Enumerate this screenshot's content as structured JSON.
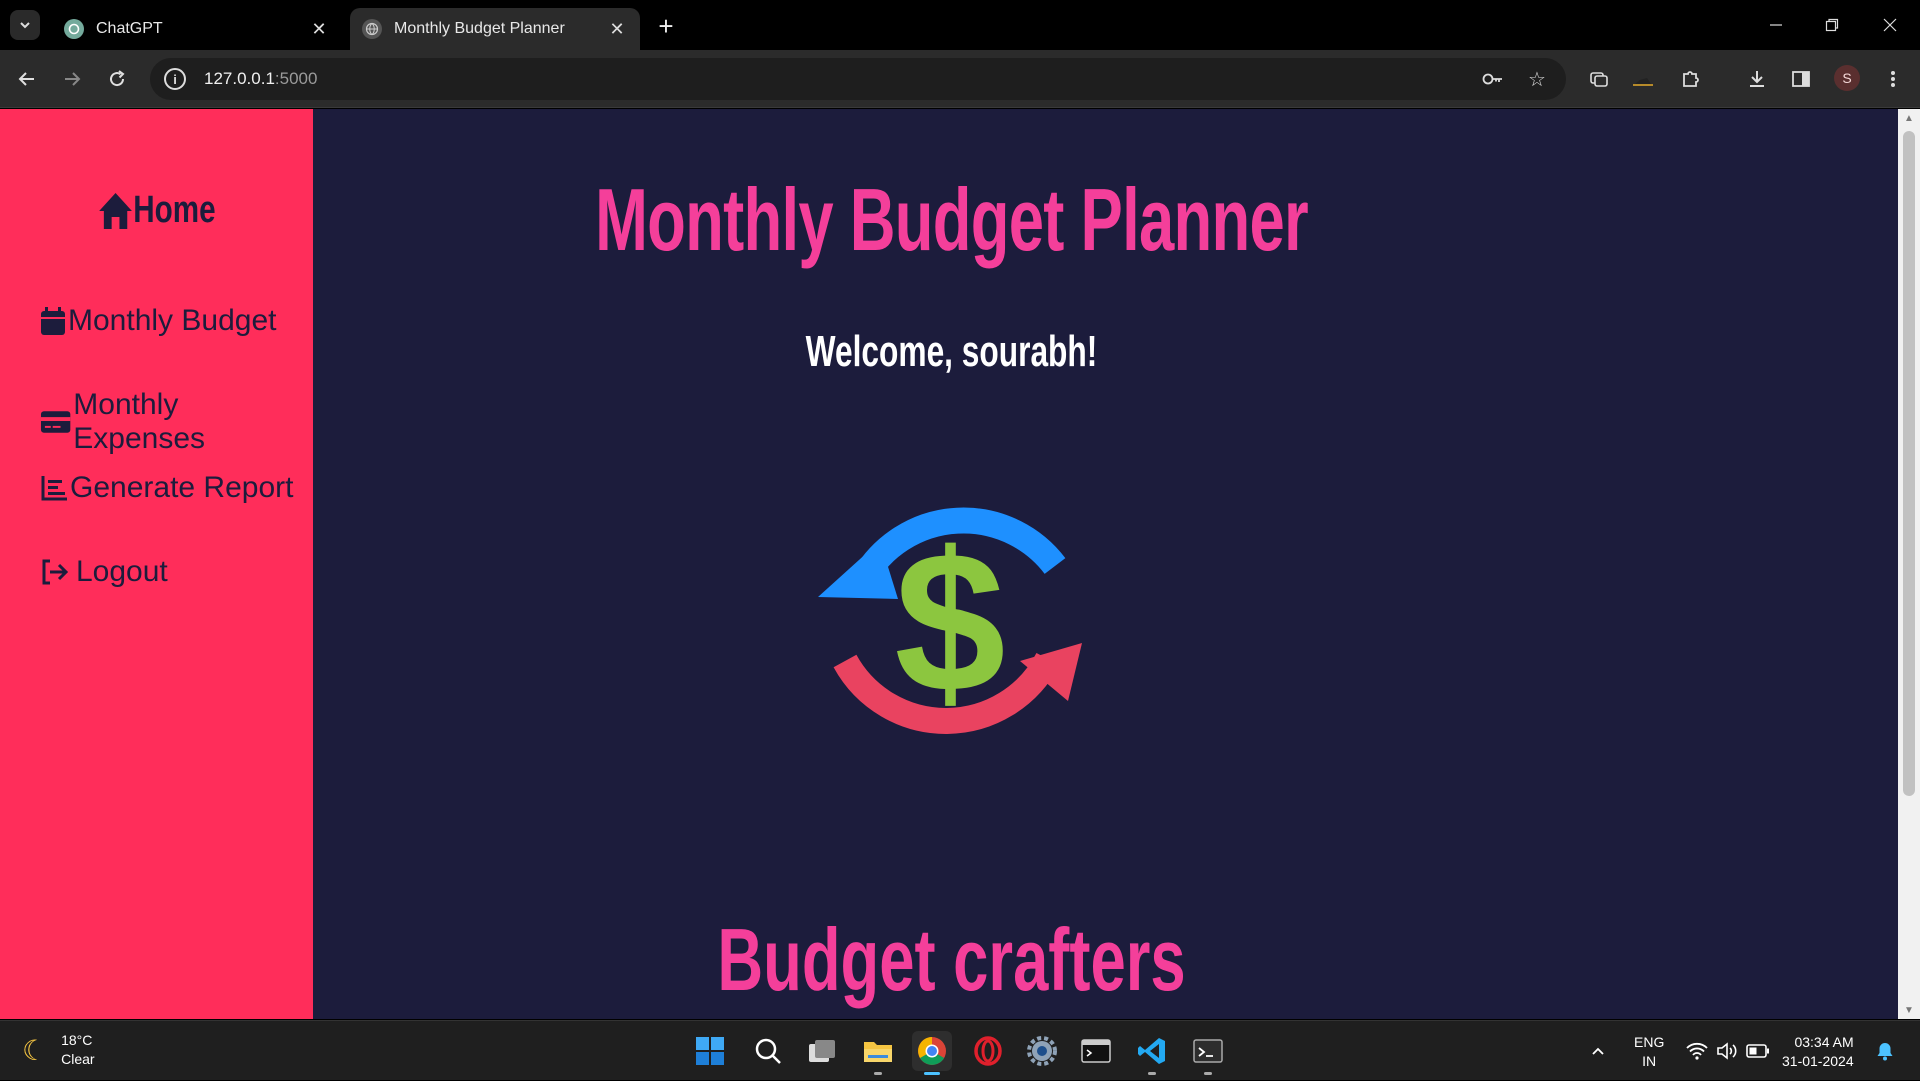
{
  "browser": {
    "tabs": [
      {
        "title": "ChatGPT",
        "active": false
      },
      {
        "title": "Monthly Budget Planner",
        "active": true
      }
    ],
    "url_host": "127.0.0.1",
    "url_port": ":5000",
    "profile_initial": "S"
  },
  "sidebar": {
    "home": "Home",
    "items": [
      {
        "label": "Monthly Budget",
        "icon": "calendar-icon"
      },
      {
        "label": "Monthly Expenses",
        "icon": "credit-card-icon"
      },
      {
        "label": "Generate Report",
        "icon": "chart-icon"
      },
      {
        "label": "Logout",
        "icon": "logout-icon"
      }
    ]
  },
  "main": {
    "title": "Monthly Budget Planner",
    "welcome": "Welcome, sourabh!",
    "footer": "Budget crafters"
  },
  "taskbar": {
    "weather_temp": "18°C",
    "weather_desc": "Clear",
    "lang_line1": "ENG",
    "lang_line2": "IN",
    "time": "03:34 AM",
    "date": "31-01-2024"
  },
  "colors": {
    "sidebar_bg": "#ff2d5a",
    "page_bg": "#1c1c3c",
    "title_pink": "#f43f9a",
    "dollar_green": "#8cc63f",
    "arrow_blue": "#1e90ff",
    "arrow_red": "#e94360"
  }
}
